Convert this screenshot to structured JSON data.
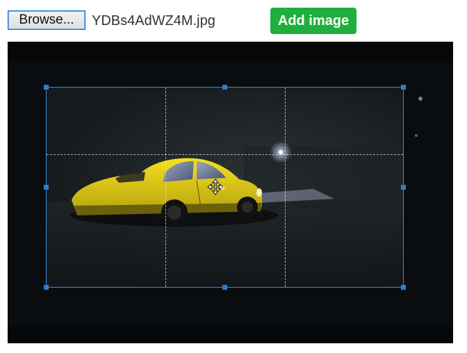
{
  "toolbar": {
    "browse_label": "Browse...",
    "file_name": "YDBs4AdWZ4M.jpg",
    "add_image_label": "Add image"
  },
  "colors": {
    "add_button": "#1faf3c",
    "crop_border": "#3a8bd6",
    "car_body": "#e8d318",
    "stage_background": "#050709"
  },
  "cropper": {
    "handles": [
      "nw",
      "n",
      "ne",
      "w",
      "e",
      "sw",
      "s",
      "se"
    ],
    "cursor_icon": "move-cursor-icon"
  }
}
